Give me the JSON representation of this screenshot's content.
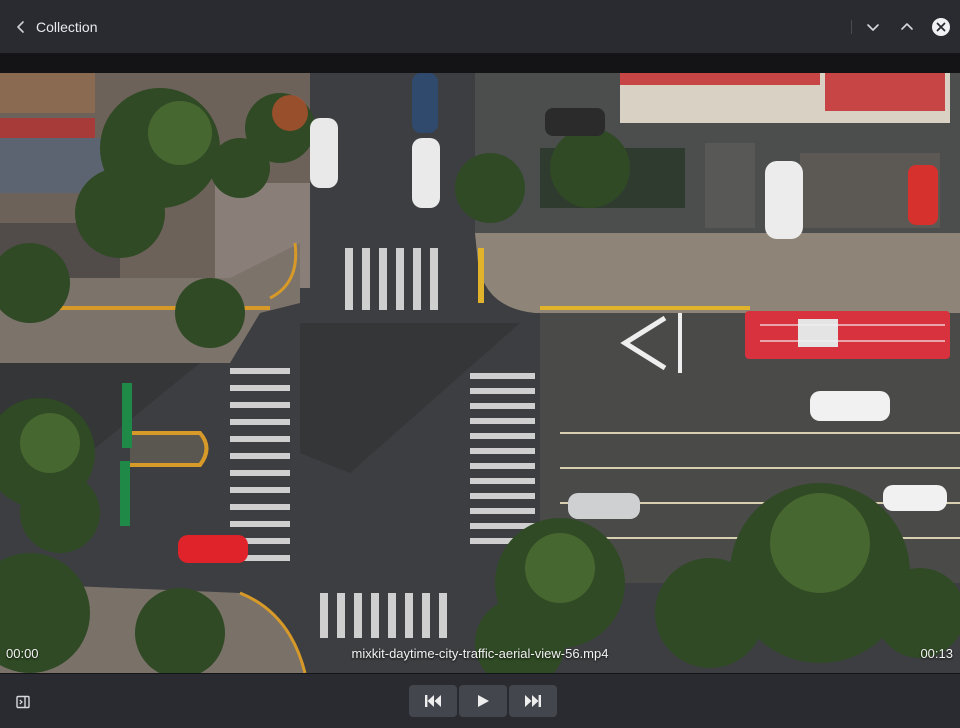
{
  "header": {
    "back_label": "Collection",
    "back_icon": "chevron-left-icon",
    "next_icon": "chevron-down-icon",
    "prev_icon": "chevron-up-icon",
    "close_icon": "close-icon"
  },
  "player": {
    "file_name": "mixkit-daytime-city-traffic-aerial-view-56.mp4",
    "current_time": "00:00",
    "duration": "00:13",
    "progress": 0.0
  },
  "controls": {
    "sidebar_icon": "sidebar-toggle-icon",
    "prev_icon": "skip-back-icon",
    "play_icon": "play-icon",
    "next_icon": "skip-forward-icon"
  },
  "colors": {
    "chrome": "#2a2b31",
    "button": "#44464d",
    "fire_truck": "#d8323f"
  }
}
